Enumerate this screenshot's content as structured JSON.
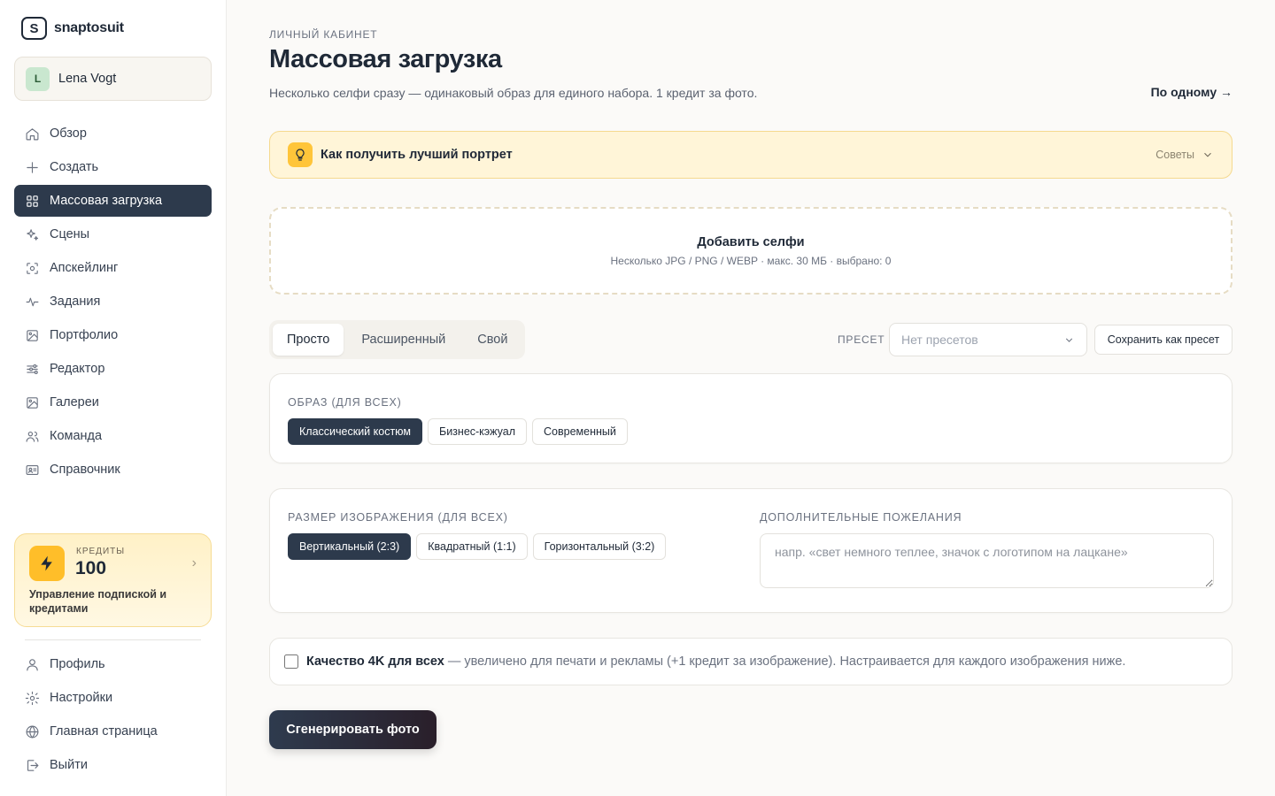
{
  "brand": {
    "name": "snaptosuit",
    "mark": "S"
  },
  "user": {
    "initial": "L",
    "name": "Lena Vogt"
  },
  "nav": {
    "items": [
      {
        "label": "Обзор",
        "icon": "home-icon",
        "active": false
      },
      {
        "label": "Создать",
        "icon": "plus-icon",
        "active": false
      },
      {
        "label": "Массовая загрузка",
        "icon": "grid-icon",
        "active": true
      },
      {
        "label": "Сцены",
        "icon": "sparkles-icon",
        "active": false
      },
      {
        "label": "Апскейлинг",
        "icon": "scan-icon",
        "active": false
      },
      {
        "label": "Задания",
        "icon": "activity-icon",
        "active": false
      },
      {
        "label": "Портфолио",
        "icon": "image-icon",
        "active": false
      },
      {
        "label": "Редактор",
        "icon": "sliders-icon",
        "active": false
      },
      {
        "label": "Галереи",
        "icon": "gallery-icon",
        "active": false
      },
      {
        "label": "Команда",
        "icon": "users-icon",
        "active": false
      },
      {
        "label": "Справочник",
        "icon": "id-card-icon",
        "active": false
      }
    ],
    "bottom": [
      {
        "label": "Профиль",
        "icon": "user-icon"
      },
      {
        "label": "Настройки",
        "icon": "gear-icon"
      },
      {
        "label": "Главная страница",
        "icon": "globe-icon"
      },
      {
        "label": "Выйти",
        "icon": "logout-icon"
      }
    ]
  },
  "credits": {
    "label": "КРЕДИТЫ",
    "value": "100",
    "description": "Управление подпиской и кредитами"
  },
  "header": {
    "eyebrow": "ЛИЧНЫЙ КАБИНЕТ",
    "title": "Массовая загрузка",
    "subtitle": "Несколько селфи сразу — одинаковый образ для единого набора. 1 кредит за фото.",
    "one_by_one": "По одному →"
  },
  "tips": {
    "title": "Как получить лучший портрет",
    "toggle": "Советы"
  },
  "dropzone": {
    "title": "Добавить селфи",
    "subtitle": "Несколько JPG / PNG / WEBP · макс. 30 МБ · выбрано: 0"
  },
  "modes": [
    "Просто",
    "Расширенный",
    "Свой"
  ],
  "active_mode": "Просто",
  "preset": {
    "label": "ПРЕСЕТ",
    "placeholder": "Нет пресетов",
    "save": "Сохранить как пресет"
  },
  "look": {
    "label": "ОБРАЗ (ДЛЯ ВСЕХ)",
    "options": [
      "Классический костюм",
      "Бизнес-кэжуал",
      "Современный"
    ],
    "selected": "Классический костюм"
  },
  "size": {
    "label": "РАЗМЕР ИЗОБРАЖЕНИЯ (ДЛЯ ВСЕХ)",
    "options": [
      "Вертикальный (2:3)",
      "Квадратный (1:1)",
      "Горизонтальный (3:2)"
    ],
    "selected": "Вертикальный (2:3)"
  },
  "wishes": {
    "label": "ДОПОЛНИТЕЛЬНЫЕ ПОЖЕЛАНИЯ",
    "placeholder": "напр. «свет немного теплее, значок с логотипом на лацкане»",
    "value": ""
  },
  "quality": {
    "title": "Качество 4K для всех",
    "description": "— увеличено для печати и рекламы (+1 кредит за изображение). Настраивается для каждого изображения ниже.",
    "checked": false
  },
  "generate": {
    "label": "Сгенерировать фото"
  },
  "colors": {
    "accent": "#2d3a4c",
    "tips_bg": "#fff5d8",
    "credits_bolt": "#ffbe29"
  }
}
